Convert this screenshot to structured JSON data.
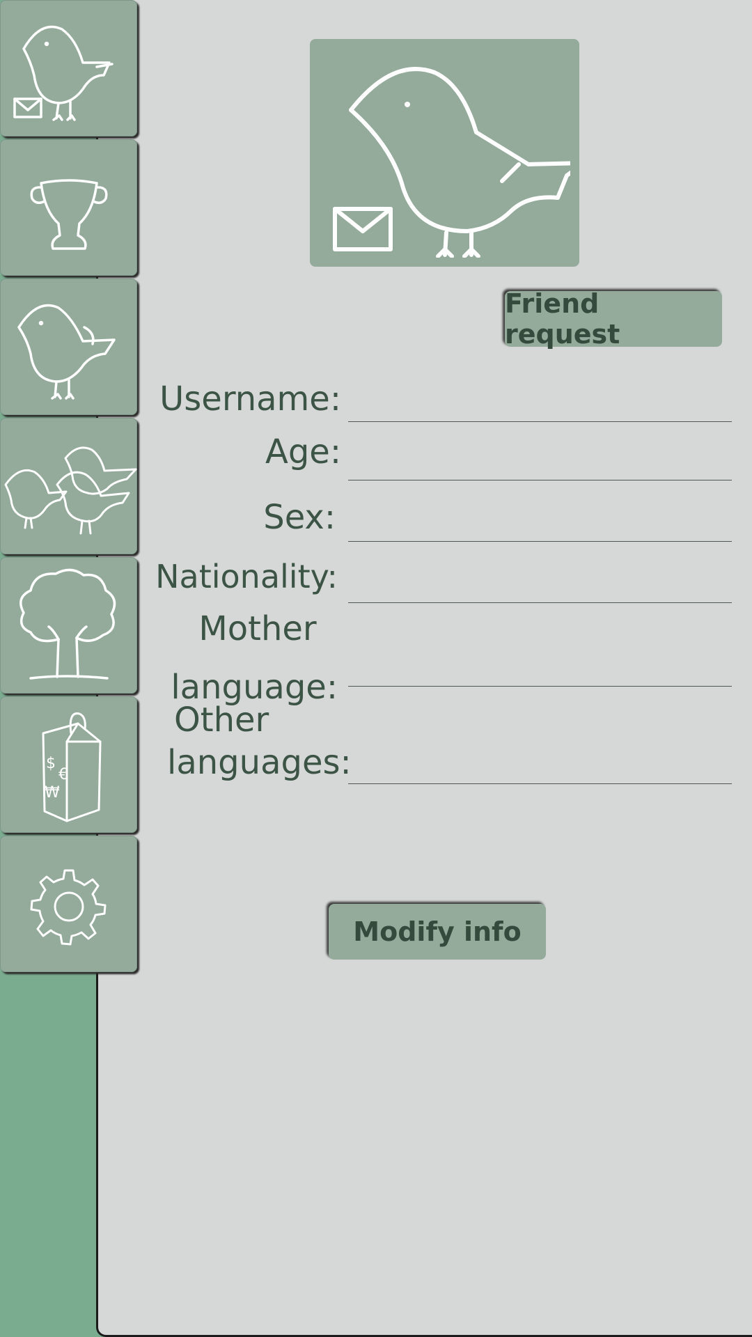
{
  "sidebar": {
    "items": [
      {
        "icon": "bird-mail-icon"
      },
      {
        "icon": "trophy-icon"
      },
      {
        "icon": "bird-icon"
      },
      {
        "icon": "bird-flock-icon"
      },
      {
        "icon": "tree-icon"
      },
      {
        "icon": "shopping-bag-icon"
      },
      {
        "icon": "gear-icon"
      }
    ]
  },
  "profile": {
    "avatar_icon": "bird-mail-icon",
    "friend_request_label": "Friend request",
    "modify_info_label": "Modify info",
    "fields": [
      {
        "label": "Username:",
        "value": ""
      },
      {
        "label": "Age:",
        "value": ""
      },
      {
        "label": "Sex:",
        "value": ""
      },
      {
        "label": "Nationality:",
        "value": ""
      },
      {
        "label_line1": "Mother",
        "label_line2": "language:",
        "value": ""
      },
      {
        "label_line1": "Other",
        "label_line2": "languages:",
        "value": ""
      }
    ]
  },
  "colors": {
    "background_green": "#7aac8f",
    "panel_gray": "#d6d8d7",
    "tile_green": "#94ab9c",
    "text_dark_green": "#3c5445"
  }
}
